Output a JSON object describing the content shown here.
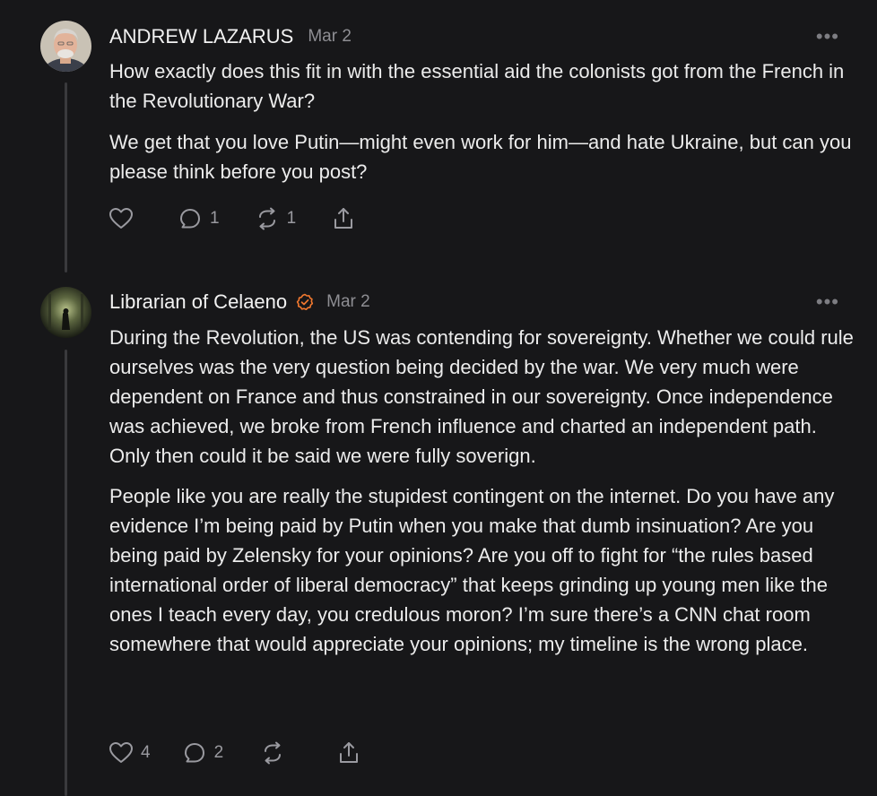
{
  "comments": [
    {
      "author": "ANDREW LAZARUS",
      "date": "Mar 2",
      "more_label": "•••",
      "paragraphs": [
        "How exactly does this fit in with the essential aid the colonists got from the French in the Revolutionary War?",
        "We get that you love Putin—might even work for him—and hate Ukraine, but can you please think before you post?"
      ],
      "likes": "",
      "replies": "1",
      "restacks": "1"
    },
    {
      "author": "Librarian of Celaeno",
      "verified": true,
      "date": "Mar 2",
      "more_label": "•••",
      "paragraphs": [
        "During the Revolution, the US was contending for sovereignty. Whether we could rule ourselves was the very question being decided by the war. We very much were dependent on France and thus constrained in our sovereignty. Once independence was achieved, we broke from French influence and charted an independent path. Only then could it be said we were fully soverign.",
        "People like you are really the stupidest contingent on the internet. Do you have any evidence I’m being paid by Putin when you make that dumb insinuation? Are you being paid by Zelensky for your opinions? Are you off to fight for “the rules based international order of liberal democracy” that keeps grinding up young men like the ones I teach every day, you credulous moron? I’m sure there’s a CNN chat room somewhere that would appreciate your opinions; my timeline is the wrong place."
      ],
      "likes": "4",
      "replies": "2",
      "restacks": ""
    }
  ],
  "colors": {
    "background": "#171719",
    "verified_badge": "#f0782f",
    "muted": "#8e8e93"
  },
  "icons": [
    "heart-icon",
    "comment-icon",
    "restack-icon",
    "share-icon",
    "verified-badge-icon",
    "more-options-icon"
  ]
}
